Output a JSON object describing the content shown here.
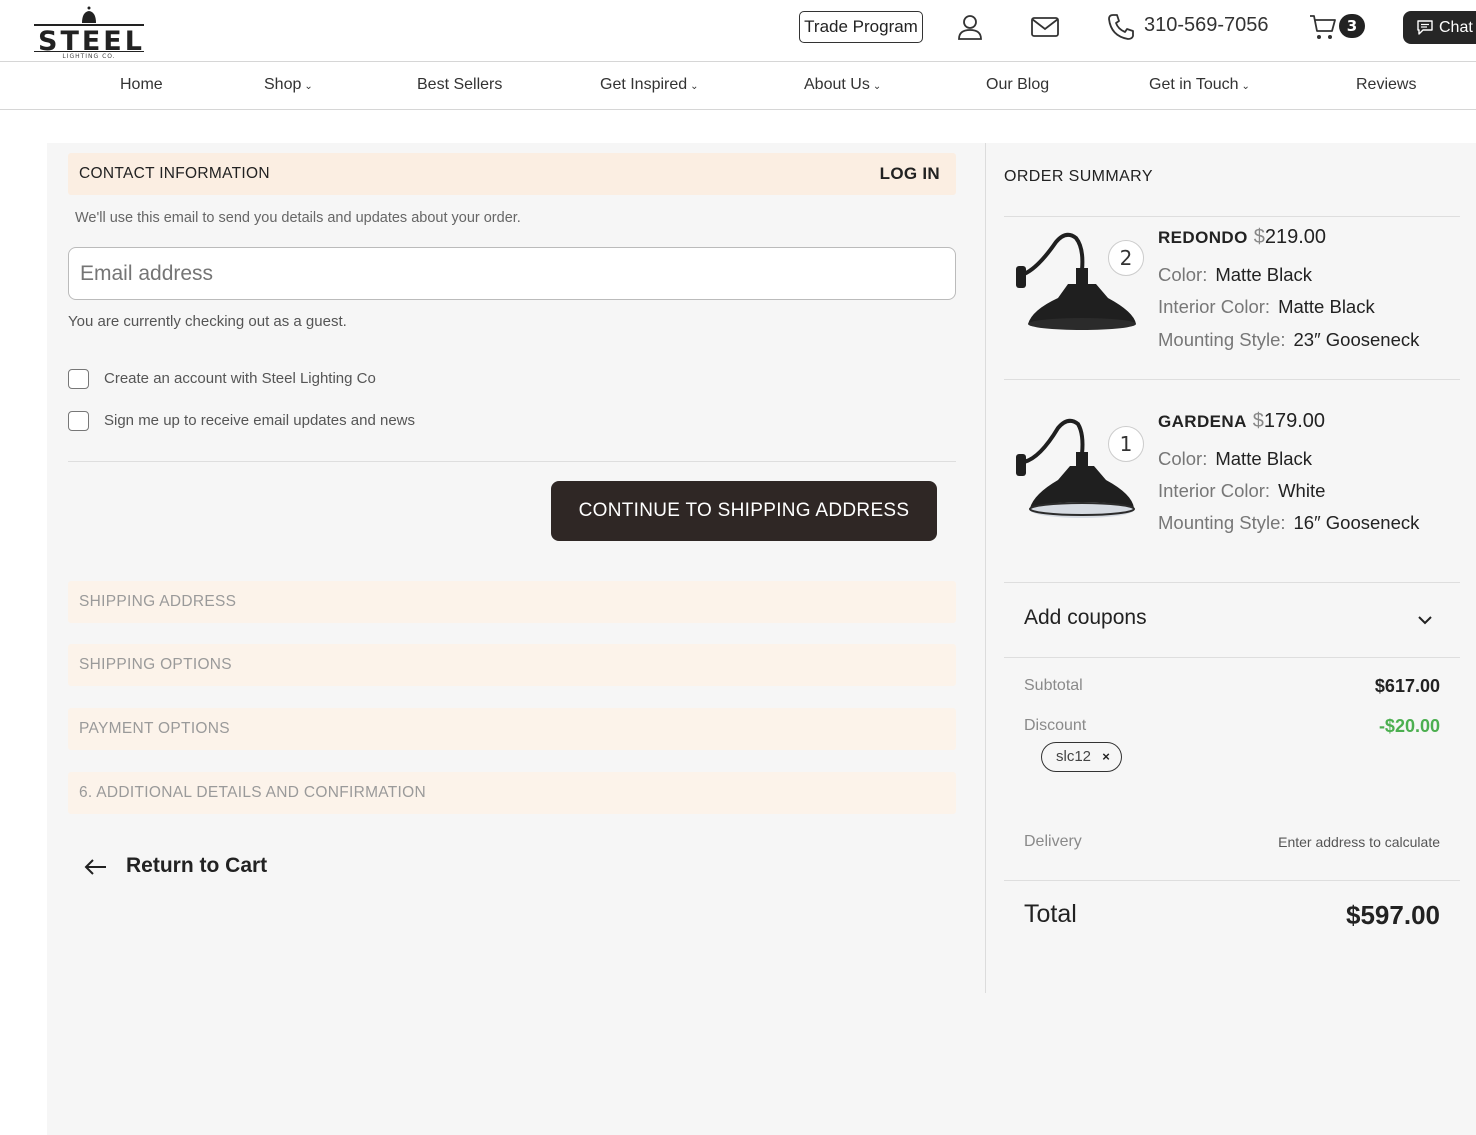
{
  "header": {
    "logo": {
      "name": "STEEL",
      "subtitle": "LIGHTING CO."
    },
    "trade_program": "Trade Program",
    "phone": "310-569-7056",
    "cart_count": "3",
    "chat_label": "Chat"
  },
  "nav": {
    "items": [
      {
        "label": "Home",
        "has_dropdown": false
      },
      {
        "label": "Shop",
        "has_dropdown": true
      },
      {
        "label": "Best Sellers",
        "has_dropdown": false
      },
      {
        "label": "Get Inspired",
        "has_dropdown": true
      },
      {
        "label": "About Us",
        "has_dropdown": true
      },
      {
        "label": "Our Blog",
        "has_dropdown": false
      },
      {
        "label": "Get in Touch",
        "has_dropdown": true
      },
      {
        "label": "Reviews",
        "has_dropdown": false
      }
    ],
    "chevron": "›"
  },
  "contact": {
    "title": "CONTACT INFORMATION",
    "login": "LOG IN",
    "help": "We'll use this email to send you details and updates about your order.",
    "email_placeholder": "Email address",
    "guest_note": "You are currently checking out as a guest.",
    "create_account": "Create an account with Steel Lighting Co",
    "subscribe": "Sign me up to receive email updates and news",
    "continue": "CONTINUE TO SHIPPING ADDRESS"
  },
  "steps": [
    "SHIPPING ADDRESS",
    "SHIPPING OPTIONS",
    "PAYMENT OPTIONS",
    "6. ADDITIONAL DETAILS AND CONFIRMATION"
  ],
  "return_to_cart": "Return to Cart",
  "summary": {
    "title": "ORDER SUMMARY",
    "items": [
      {
        "name": "REDONDO",
        "currency": "$",
        "price": "219.00",
        "qty": "2",
        "attrs": [
          {
            "k": "Color:",
            "v": "Matte Black"
          },
          {
            "k": "Interior Color:",
            "v": "Matte Black"
          },
          {
            "k": "Mounting Style:",
            "v": "23″ Gooseneck"
          }
        ]
      },
      {
        "name": "GARDENA",
        "currency": "$",
        "price": "179.00",
        "qty": "1",
        "attrs": [
          {
            "k": "Color:",
            "v": "Matte Black"
          },
          {
            "k": "Interior Color:",
            "v": "White"
          },
          {
            "k": "Mounting Style:",
            "v": "16″ Gooseneck"
          }
        ]
      }
    ],
    "coupons_label": "Add coupons",
    "subtotal_label": "Subtotal",
    "subtotal": "$617.00",
    "discount_label": "Discount",
    "discount": "-$20.00",
    "coupon_code": "slc12",
    "coupon_remove": "×",
    "delivery_label": "Delivery",
    "delivery_note": "Enter address to calculate",
    "total_label": "Total",
    "total": "$597.00"
  },
  "colors": {
    "accent_dark": "#2f2725",
    "section_bg": "#fbeee2",
    "discount_green": "#4caf50"
  }
}
